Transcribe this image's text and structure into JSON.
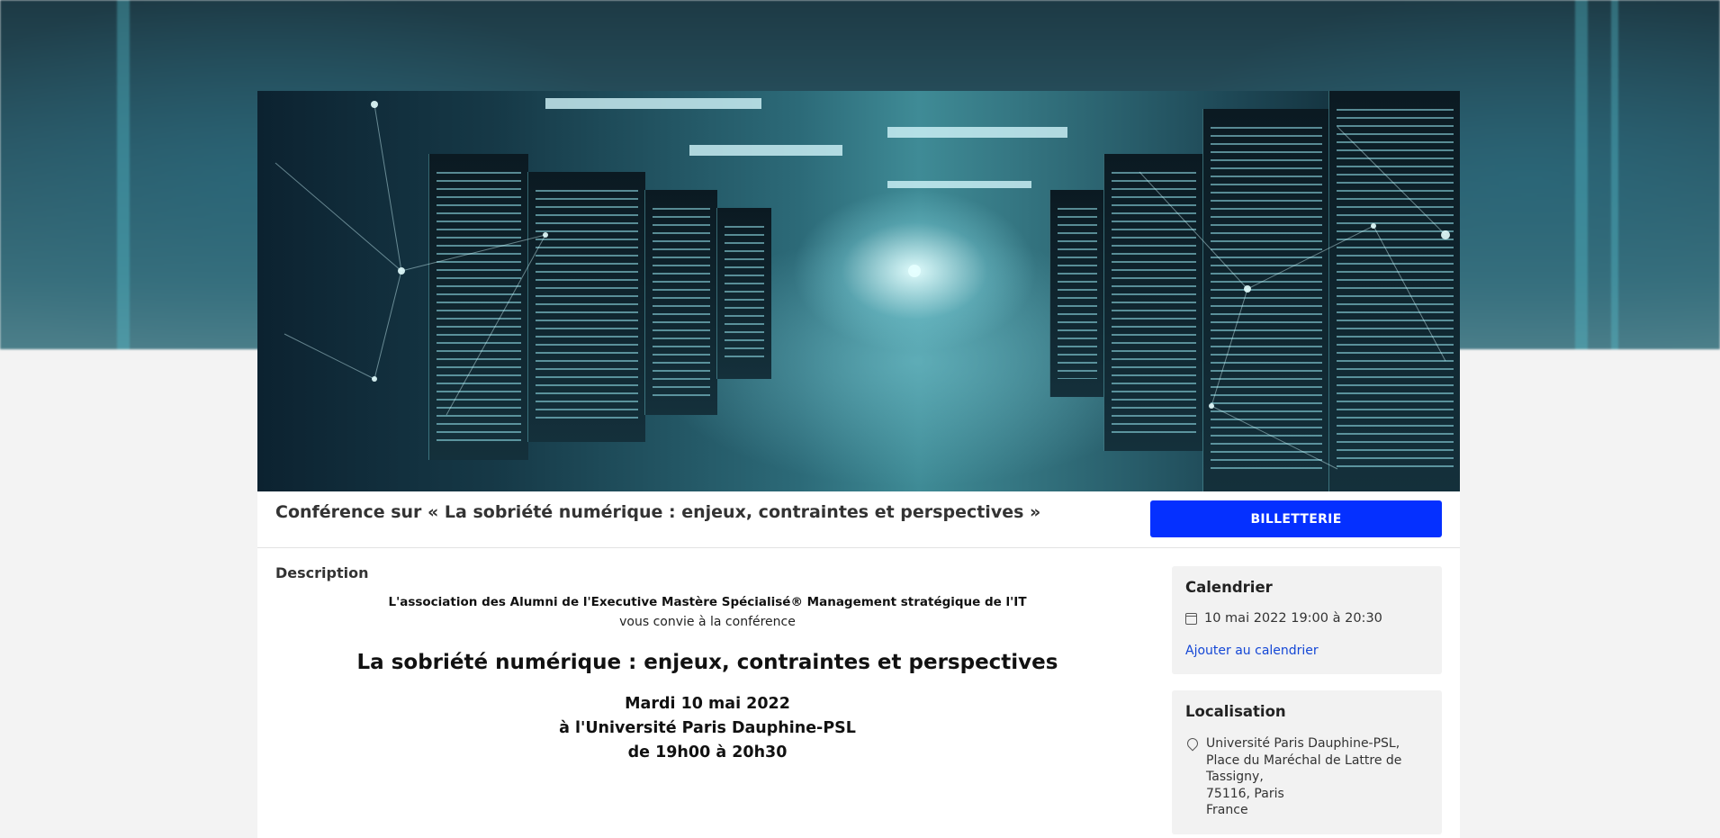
{
  "event": {
    "title": "Conférence sur « La sobriété numérique : enjeux, contraintes et perspectives »",
    "ticket_label": "BILLETTERIE"
  },
  "description": {
    "heading": "Description",
    "organizer_line": "L'association des Alumni de l'Executive Mastère Spécialisé® Management stratégique de l'IT",
    "invite_line": "vous convie à la conférence",
    "conference_title": "La sobriété numérique : enjeux, contraintes et perspectives",
    "date_line": "Mardi 10 mai 2022",
    "place_line": "à l'Université Paris Dauphine-PSL",
    "time_line": "de 19h00 à 20h30"
  },
  "calendar": {
    "heading": "Calendrier",
    "datetime": "10 mai 2022 19:00 à 20:30",
    "add_link": "Ajouter au calendrier"
  },
  "location": {
    "heading": "Localisation",
    "lines": [
      "Université Paris Dauphine-PSL,",
      "Place du Maréchal de Lattre de",
      "Tassigny,",
      "75116, Paris",
      "France"
    ]
  },
  "colors": {
    "accent_button": "#0530ff",
    "link": "#1447d6"
  },
  "icons": {
    "calendar": "calendar-icon",
    "location": "map-pin-icon"
  }
}
